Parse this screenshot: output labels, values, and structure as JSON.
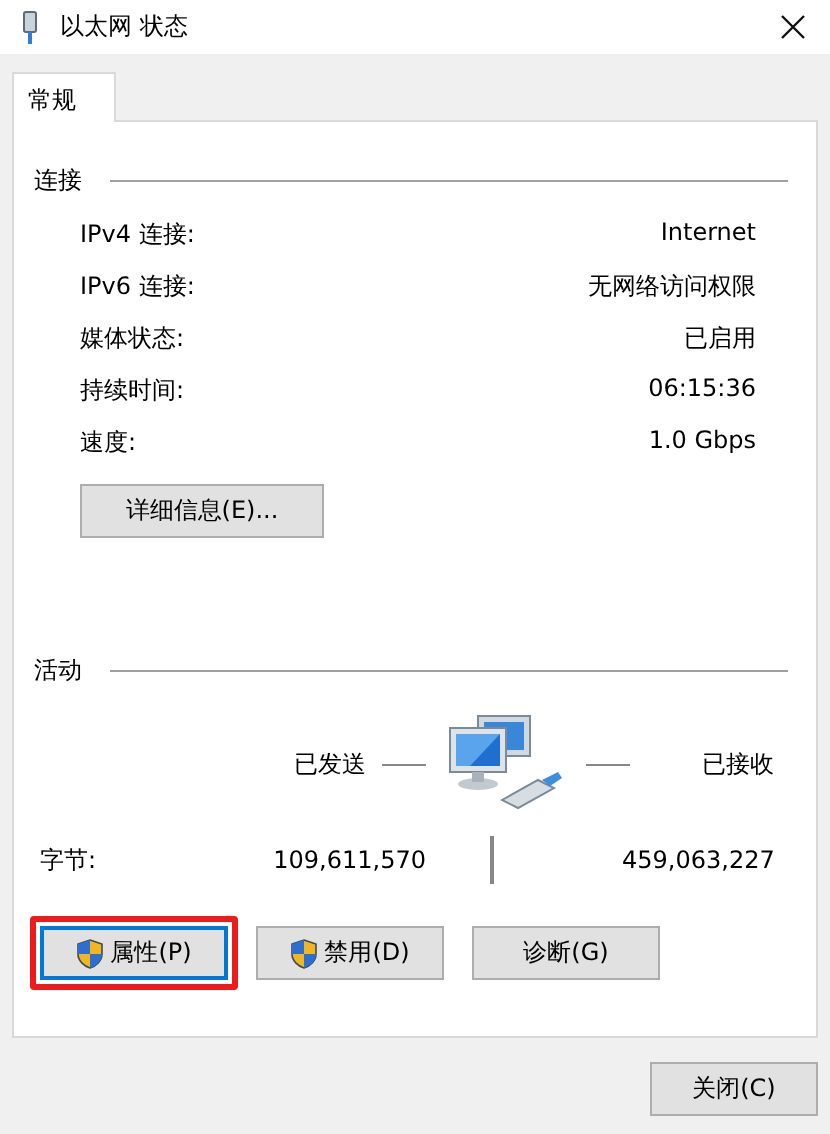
{
  "window": {
    "title": "以太网 状态"
  },
  "tabs": [
    {
      "label": "常规",
      "selected": true
    }
  ],
  "connection": {
    "heading": "连接",
    "rows": [
      {
        "label": "IPv4 连接:",
        "value": "Internet"
      },
      {
        "label": "IPv6 连接:",
        "value": "无网络访问权限"
      },
      {
        "label": "媒体状态:",
        "value": "已启用"
      },
      {
        "label": "持续时间:",
        "value": "06:15:36"
      },
      {
        "label": "速度:",
        "value": "1.0 Gbps"
      }
    ],
    "details_button": "详细信息(E)..."
  },
  "activity": {
    "heading": "活动",
    "sent_label": "已发送",
    "received_label": "已接收",
    "bytes_label": "字节:",
    "bytes_sent": "109,611,570",
    "bytes_received": "459,063,227"
  },
  "buttons": [
    {
      "label": "属性(P)",
      "shield": true,
      "selected": true,
      "highlighted": true
    },
    {
      "label": "禁用(D)",
      "shield": true,
      "selected": false,
      "highlighted": false
    },
    {
      "label": "诊断(G)",
      "shield": false,
      "selected": false,
      "highlighted": false
    }
  ],
  "close_button": "关闭(C)"
}
